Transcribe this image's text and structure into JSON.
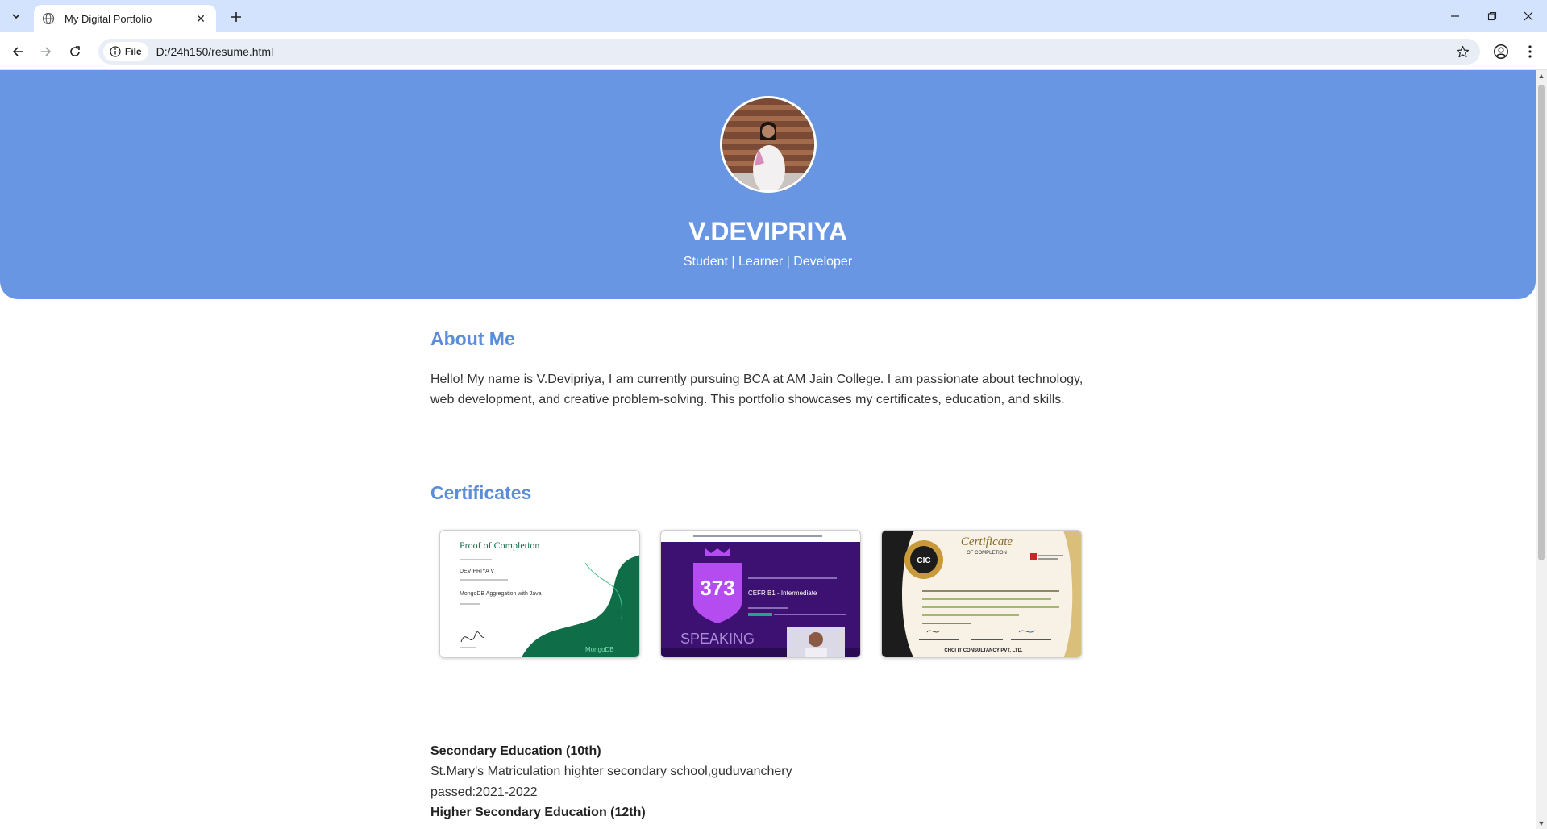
{
  "browser": {
    "tab_title": "My Digital Portfolio",
    "address_chip": "File",
    "url": "D:/24h150/resume.html"
  },
  "hero": {
    "name": "V.DEVIPRIYA",
    "tagline": "Student | Learner | Developer"
  },
  "about": {
    "heading": "About Me",
    "text": "Hello! My name is V.Devipriya, I am currently pursuing BCA at AM Jain College. I am passionate about technology, web development, and creative problem-solving. This portfolio showcases my certificates, education, and skills."
  },
  "certificates": {
    "heading": "Certificates",
    "items": [
      {
        "heading": "Proof of Completion",
        "recipient": "DEVIPRIYA V",
        "course": "MongoDB Aggregation with Java",
        "brand": "MongoDB"
      },
      {
        "score": "373",
        "level": "CEFR B1 - Intermediate",
        "skill": "SPEAKING"
      },
      {
        "heading": "Certificate",
        "subheading": "OF COMPLETION",
        "badge": "CIC",
        "issuer": "CHCI IT CONSULTANCY PVT. LTD."
      }
    ]
  },
  "education": {
    "secondary_title": "Secondary Education (10th)",
    "secondary_school": "St.Mary's Matriculation highter secondary school,guduvanchery",
    "secondary_passed": "passed:2021-2022",
    "higher_title": "Higher Secondary Education (12th)"
  },
  "colors": {
    "accent": "#5b8dd9",
    "hero_bg": "#6896e2",
    "browser_chrome": "#d3e3fd"
  }
}
